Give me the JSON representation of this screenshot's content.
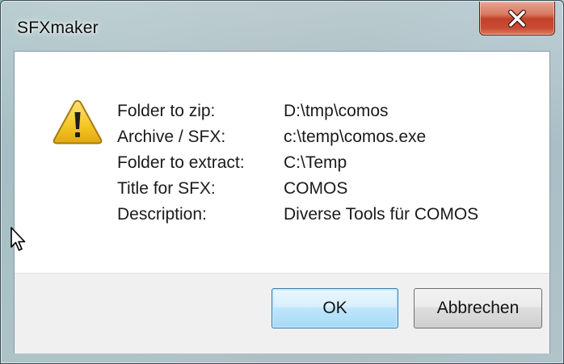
{
  "window": {
    "title": "SFXmaker"
  },
  "message": {
    "icon": "warning-icon",
    "rows": [
      {
        "label": "Folder to zip:",
        "value": "D:\\tmp\\comos"
      },
      {
        "label": "Archive / SFX:",
        "value": "c:\\temp\\comos.exe"
      },
      {
        "label": "Folder to extract:",
        "value": "C:\\Temp"
      },
      {
        "label": "Title for SFX:",
        "value": "COMOS"
      },
      {
        "label": "Description:",
        "value": "Diverse Tools für COMOS"
      }
    ]
  },
  "buttons": {
    "ok_label": "OK",
    "cancel_label": "Abbrechen"
  },
  "colors": {
    "close_button": "#c94b33",
    "default_button_border": "#3c7fb1",
    "warning_fill": "#f3c623"
  }
}
